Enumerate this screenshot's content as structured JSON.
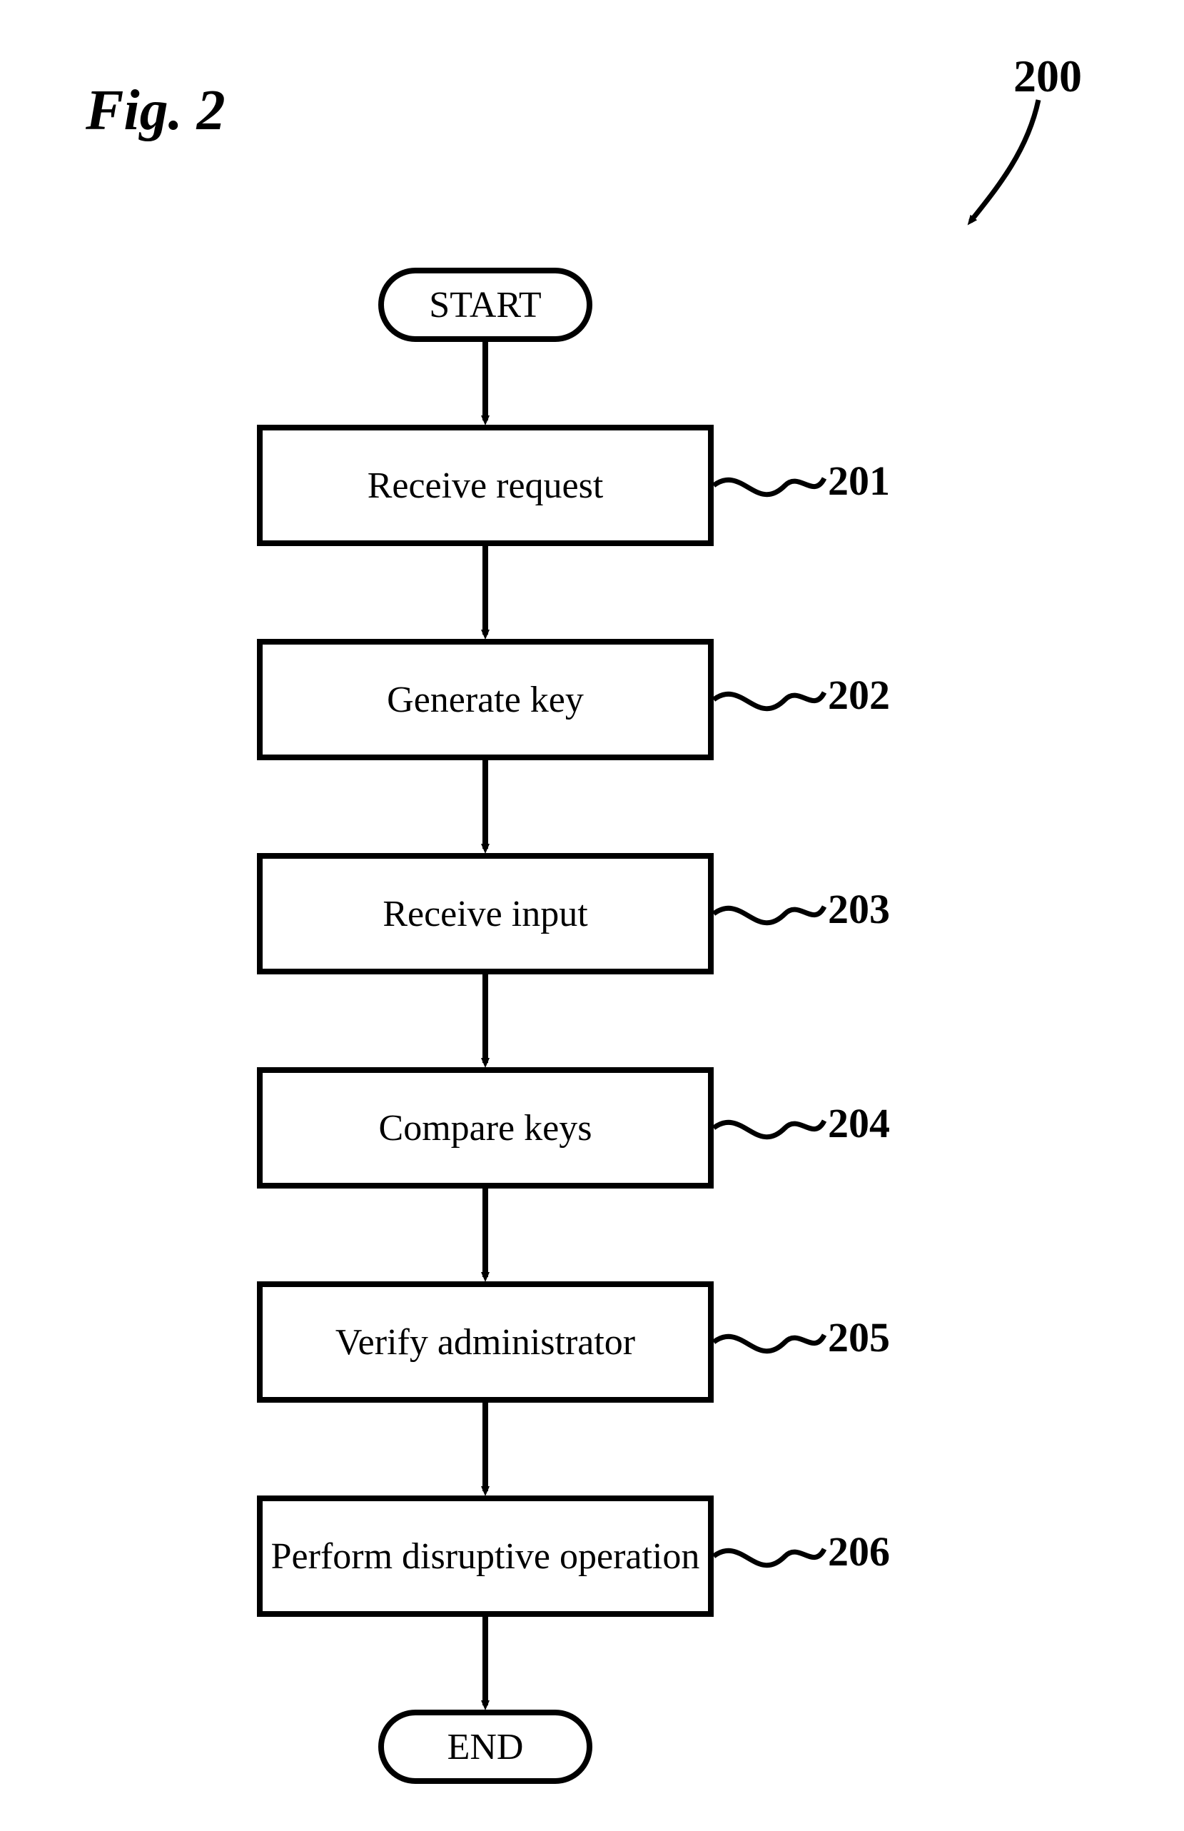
{
  "figure": {
    "title": "Fig. 2",
    "overall_ref": "200"
  },
  "nodes": {
    "start": "START",
    "end": "END",
    "step201": "Receive request",
    "step202": "Generate key",
    "step203": "Receive input",
    "step204": "Compare keys",
    "step205": "Verify administrator",
    "step206": "Perform disruptive operation"
  },
  "labels": {
    "l201": "201",
    "l202": "202",
    "l203": "203",
    "l204": "204",
    "l205": "205",
    "l206": "206"
  }
}
